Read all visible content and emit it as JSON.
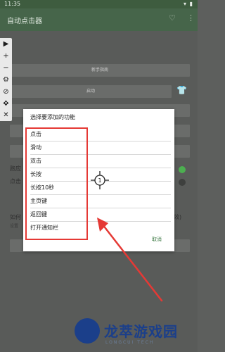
{
  "status": {
    "time": "11:35",
    "icons": "▾ ▮"
  },
  "app": {
    "title": "自动点击器",
    "action_icons": [
      "heart-shield-icon",
      "more-vert-icon"
    ]
  },
  "toolbar": {
    "icons": [
      "▶",
      "+",
      "−",
      "⚙",
      "⊘",
      "✥",
      "✕"
    ]
  },
  "background": {
    "btn_newbie": "新手指南",
    "btn_start": "启动",
    "label_toggle1": "跑应",
    "label_toggle2": "点击",
    "label_how": "如何",
    "label_more": "设置",
    "label_effect": "效)"
  },
  "dialog": {
    "title": "选择要添加的功能",
    "items": [
      "点击",
      "滑动",
      "双击",
      "长按",
      "长按10秒",
      "主页键",
      "返回键",
      "打开通知栏"
    ],
    "cancel": "取消"
  },
  "crosshair_label": "1",
  "watermark": {
    "brand": "龙萃游戏园",
    "sub": "LONGCUI TECH"
  },
  "colors": {
    "accent": "#46654a",
    "highlight": "#e53935",
    "toggle_on": "#4caf50",
    "watermark": "#1b3f8a"
  }
}
